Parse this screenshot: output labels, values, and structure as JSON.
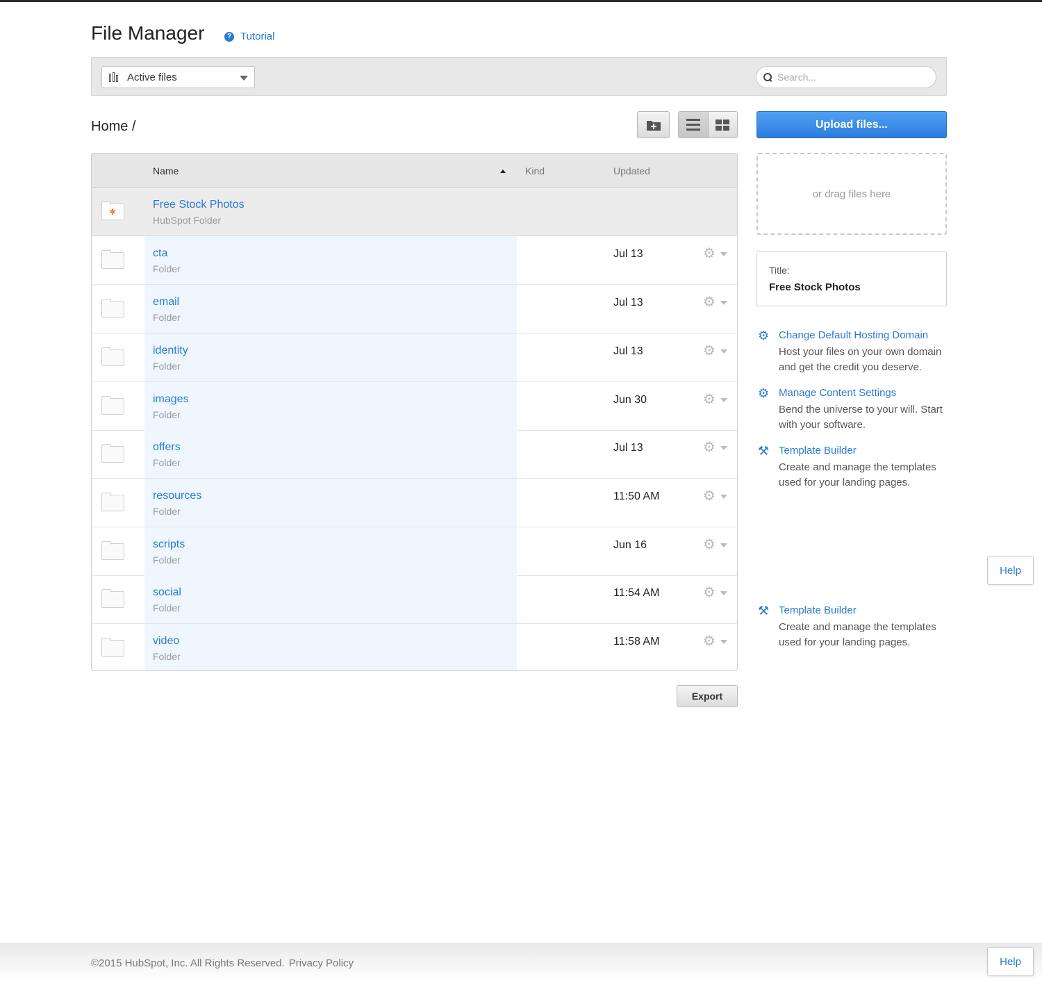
{
  "header": {
    "title": "File Manager",
    "tutorial_label": "Tutorial"
  },
  "toolbar": {
    "filter_selected": "Active files",
    "search_placeholder": "Search..."
  },
  "breadcrumb": "Home /",
  "table": {
    "columns": {
      "name": "Name",
      "kind": "Kind",
      "updated": "Updated"
    },
    "featured": {
      "name": "Free Stock Photos",
      "kind": "HubSpot Folder"
    },
    "rows": [
      {
        "name": "cta",
        "kind": "Folder",
        "updated": "Jul 13"
      },
      {
        "name": "email",
        "kind": "Folder",
        "updated": "Jul 13"
      },
      {
        "name": "identity",
        "kind": "Folder",
        "updated": "Jul 13"
      },
      {
        "name": "images",
        "kind": "Folder",
        "updated": "Jun 30"
      },
      {
        "name": "offers",
        "kind": "Folder",
        "updated": "Jul 13"
      },
      {
        "name": "resources",
        "kind": "Folder",
        "updated": "11:50 AM"
      },
      {
        "name": "scripts",
        "kind": "Folder",
        "updated": "Jun 16"
      },
      {
        "name": "social",
        "kind": "Folder",
        "updated": "11:54 AM"
      },
      {
        "name": "video",
        "kind": "Folder",
        "updated": "11:58 AM"
      }
    ]
  },
  "export_label": "Export",
  "sidebar": {
    "upload_label": "Upload files...",
    "drop_label": "or drag files here",
    "title_label": "Title:",
    "title_value": "Free Stock Photos",
    "links": [
      {
        "icon": "gear-icon",
        "label": "Change Default Hosting Domain",
        "desc": "Host your files on your own domain and get the credit you deserve."
      },
      {
        "icon": "gear-icon",
        "label": "Manage Content Settings",
        "desc": "Bend the universe to your will. Start with your software."
      },
      {
        "icon": "tools-icon",
        "label": "Template Builder",
        "desc": "Create and manage the templates used for your landing pages."
      },
      {
        "icon": "tools-icon",
        "label": "Template Builder",
        "desc": "Create and manage the templates used for your landing pages."
      }
    ]
  },
  "help_label": "Help",
  "footer": {
    "copyright": "©2015 HubSpot, Inc. All Rights Reserved.",
    "privacy": "Privacy Policy"
  },
  "colors": {
    "accent": "#2a7ad4",
    "hubspot_orange": "#f27d4a"
  }
}
